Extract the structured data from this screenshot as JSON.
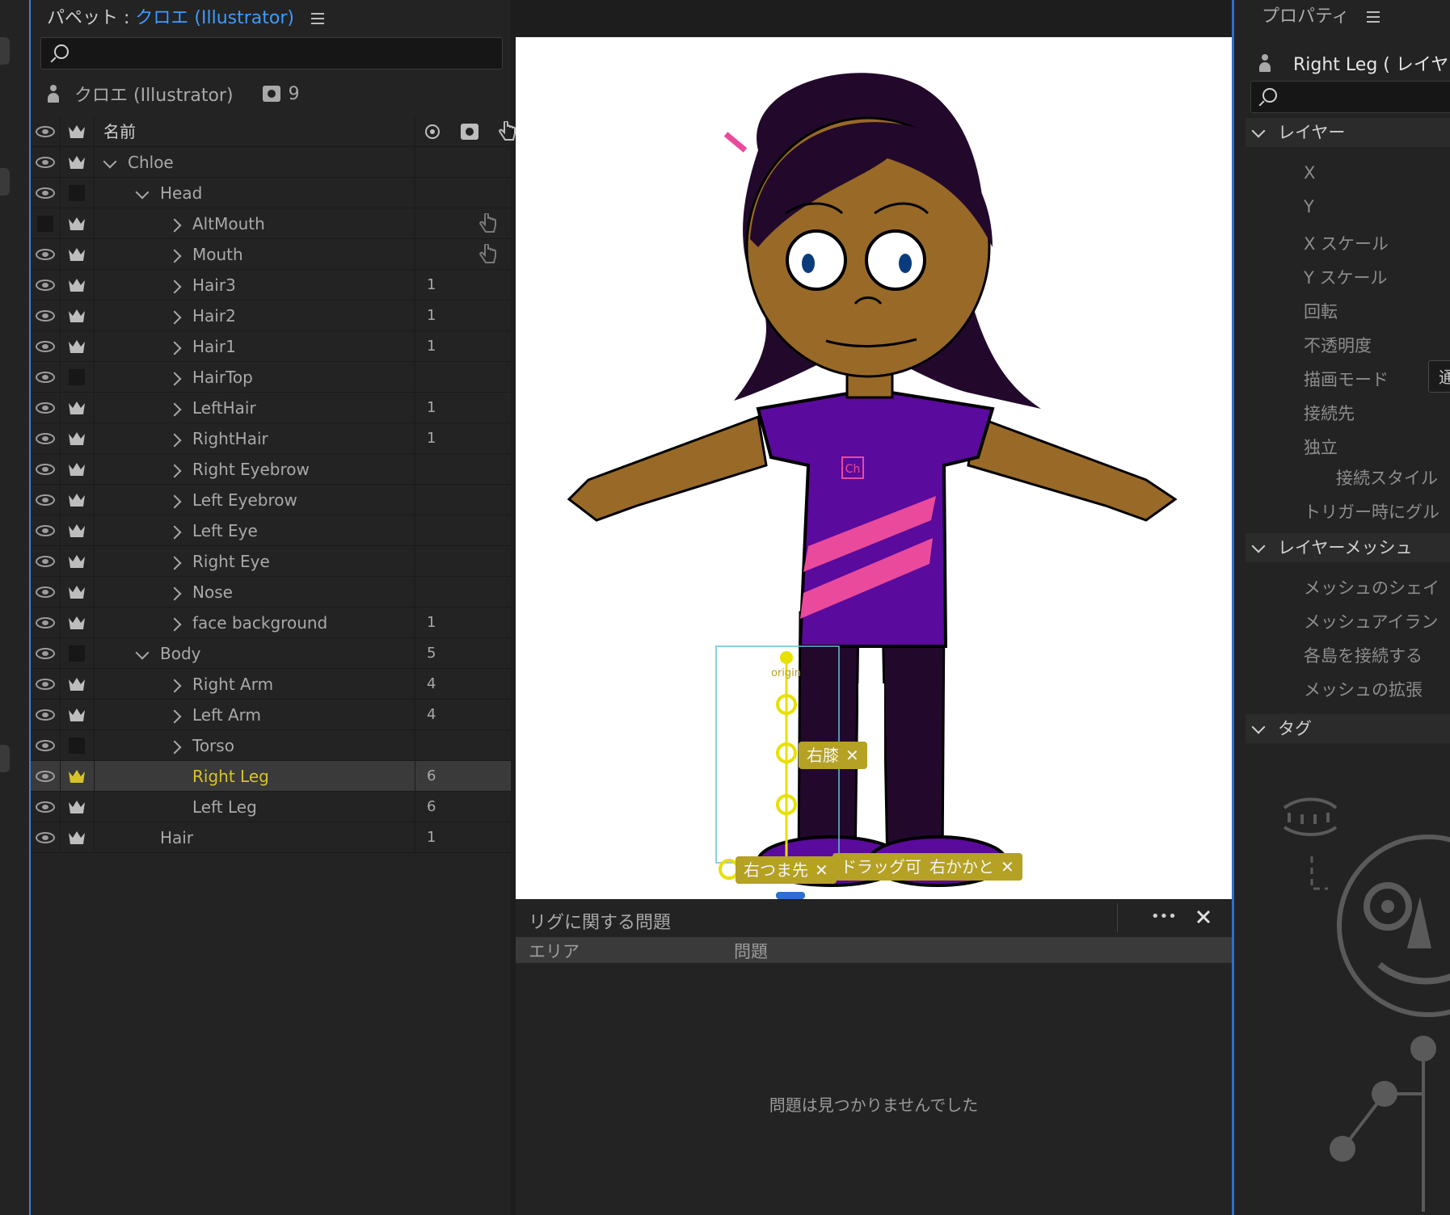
{
  "puppet_panel": {
    "title_prefix": "パペット :",
    "title_puppet": "クロエ (Illustrator)",
    "search_placeholder": "",
    "puppet_name": "クロエ (Illustrator)",
    "behavior_count": "9",
    "column_name": "名前"
  },
  "tree": [
    {
      "label": "Chloe",
      "level": 0,
      "expand": "down",
      "eye": true,
      "crown": true,
      "num": "",
      "hand": false,
      "selected": false
    },
    {
      "label": "Head",
      "level": 1,
      "expand": "down",
      "eye": true,
      "crown": false,
      "num": "",
      "hand": false,
      "selected": false
    },
    {
      "label": "AltMouth",
      "level": 2,
      "expand": "right",
      "eye": false,
      "crown": true,
      "num": "",
      "hand": true,
      "selected": false
    },
    {
      "label": "Mouth",
      "level": 2,
      "expand": "right",
      "eye": true,
      "crown": true,
      "num": "",
      "hand": true,
      "selected": false
    },
    {
      "label": "Hair3",
      "level": 2,
      "expand": "right",
      "eye": true,
      "crown": true,
      "num": "1",
      "hand": false,
      "selected": false
    },
    {
      "label": "Hair2",
      "level": 2,
      "expand": "right",
      "eye": true,
      "crown": true,
      "num": "1",
      "hand": false,
      "selected": false
    },
    {
      "label": "Hair1",
      "level": 2,
      "expand": "right",
      "eye": true,
      "crown": true,
      "num": "1",
      "hand": false,
      "selected": false
    },
    {
      "label": "HairTop",
      "level": 2,
      "expand": "right",
      "eye": true,
      "crown": false,
      "num": "",
      "hand": false,
      "selected": false
    },
    {
      "label": "LeftHair",
      "level": 2,
      "expand": "right",
      "eye": true,
      "crown": true,
      "num": "1",
      "hand": false,
      "selected": false
    },
    {
      "label": "RightHair",
      "level": 2,
      "expand": "right",
      "eye": true,
      "crown": true,
      "num": "1",
      "hand": false,
      "selected": false
    },
    {
      "label": "Right Eyebrow",
      "level": 2,
      "expand": "right",
      "eye": true,
      "crown": true,
      "num": "",
      "hand": false,
      "selected": false
    },
    {
      "label": "Left Eyebrow",
      "level": 2,
      "expand": "right",
      "eye": true,
      "crown": true,
      "num": "",
      "hand": false,
      "selected": false
    },
    {
      "label": "Left Eye",
      "level": 2,
      "expand": "right",
      "eye": true,
      "crown": true,
      "num": "",
      "hand": false,
      "selected": false
    },
    {
      "label": "Right Eye",
      "level": 2,
      "expand": "right",
      "eye": true,
      "crown": true,
      "num": "",
      "hand": false,
      "selected": false
    },
    {
      "label": "Nose",
      "level": 2,
      "expand": "right",
      "eye": true,
      "crown": true,
      "num": "",
      "hand": false,
      "selected": false
    },
    {
      "label": "face background",
      "level": 2,
      "expand": "right",
      "eye": true,
      "crown": true,
      "num": "1",
      "hand": false,
      "selected": false
    },
    {
      "label": "Body",
      "level": 1,
      "expand": "down",
      "eye": true,
      "crown": false,
      "num": "5",
      "hand": false,
      "selected": false
    },
    {
      "label": "Right Arm",
      "level": 2,
      "expand": "right",
      "eye": true,
      "crown": true,
      "num": "4",
      "hand": false,
      "selected": false
    },
    {
      "label": "Left Arm",
      "level": 2,
      "expand": "right",
      "eye": true,
      "crown": true,
      "num": "4",
      "hand": false,
      "selected": false
    },
    {
      "label": "Torso",
      "level": 2,
      "expand": "right",
      "eye": true,
      "crown": false,
      "num": "",
      "hand": false,
      "selected": false
    },
    {
      "label": "Right Leg",
      "level": 2,
      "expand": "none",
      "eye": true,
      "crown": true,
      "num": "6",
      "hand": false,
      "selected": true
    },
    {
      "label": "Left Leg",
      "level": 2,
      "expand": "none",
      "eye": true,
      "crown": true,
      "num": "6",
      "hand": false,
      "selected": false
    },
    {
      "label": "Hair",
      "level": 1,
      "expand": "none",
      "eye": true,
      "crown": true,
      "num": "1",
      "hand": false,
      "selected": false
    }
  ],
  "canvas": {
    "logo_text": "Ch",
    "origin_label": "origin",
    "tags": [
      {
        "label": "右膝"
      },
      {
        "label": "右つま先"
      },
      {
        "label": "ドラッグ可能"
      },
      {
        "label": "右かかと"
      }
    ]
  },
  "rig_panel": {
    "title": "リグに関する問題",
    "col_area": "エリア",
    "col_issue": "問題",
    "empty_message": "問題は見つかりませんでした",
    "more_label": "•••"
  },
  "properties": {
    "title": "プロパティ",
    "layer_name": "Right Leg ( レイヤー",
    "sections": {
      "layer": "レイヤー",
      "layer_mesh": "レイヤーメッシュ",
      "tags": "タグ"
    },
    "layer_props": [
      "X",
      "Y",
      "X スケール",
      "Y スケール",
      "回転",
      "不透明度",
      "描画モード",
      "接続先",
      "独立"
    ],
    "connect_style": "接続スタイル",
    "trigger_group": "トリガー時にグル",
    "blend_value": "通",
    "mesh_props": [
      "メッシュのシェイ",
      "メッシュアイラン",
      "各島を接続する",
      "メッシュの拡張"
    ]
  },
  "colors": {
    "accent_blue": "#3d9bff",
    "selection_yellow": "#d6c32a",
    "skin": "#996a27",
    "hair": "#22092b",
    "shirt": "#5a0a9c",
    "stripe": "#ea4a9c",
    "tag_bg": "#b5a123"
  }
}
